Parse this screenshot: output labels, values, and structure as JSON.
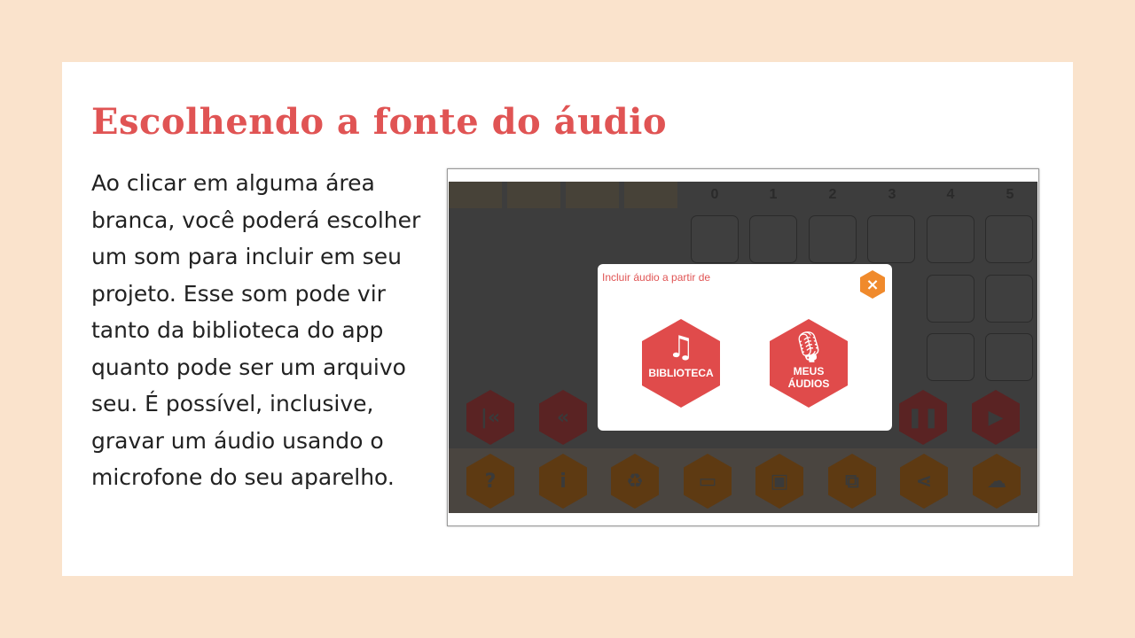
{
  "slide": {
    "title": "Escolhendo a fonte do áudio",
    "body": "Ao clicar em alguma área branca, você poderá escolher um som para incluir em seu projeto. Esse som pode vir tanto da biblioteca do app quanto pode ser um arquivo seu. É possível, inclusive, gravar um áudio usando o microfone do seu aparelho."
  },
  "grid": {
    "column_labels": [
      "0",
      "1",
      "2",
      "3",
      "4",
      "5"
    ]
  },
  "dialog": {
    "title": "Incluir áudio a partir de",
    "close_icon": "×",
    "option_library": {
      "icon": "music-note-icon",
      "glyph": "♫",
      "label": "BIBLIOTECA"
    },
    "option_my_audios": {
      "icon": "microphone-icon",
      "glyph": "🎙",
      "label_line1": "MEUS",
      "label_line2": "ÁUDIOS"
    }
  },
  "controls": {
    "playback_icons": [
      "skip-to-start-icon",
      "rewind-icon",
      "pause-icon",
      "play-icon"
    ],
    "tool_icons": [
      "help-icon",
      "info-icon",
      "recycle-icon",
      "open-folder-icon",
      "save-icon",
      "copy-icon",
      "share-icon",
      "cloud-download-icon"
    ]
  },
  "colors": {
    "background": "#fae3cc",
    "title": "#e05454",
    "accent_red": "#e04b4b",
    "accent_orange": "#f08a2c"
  }
}
